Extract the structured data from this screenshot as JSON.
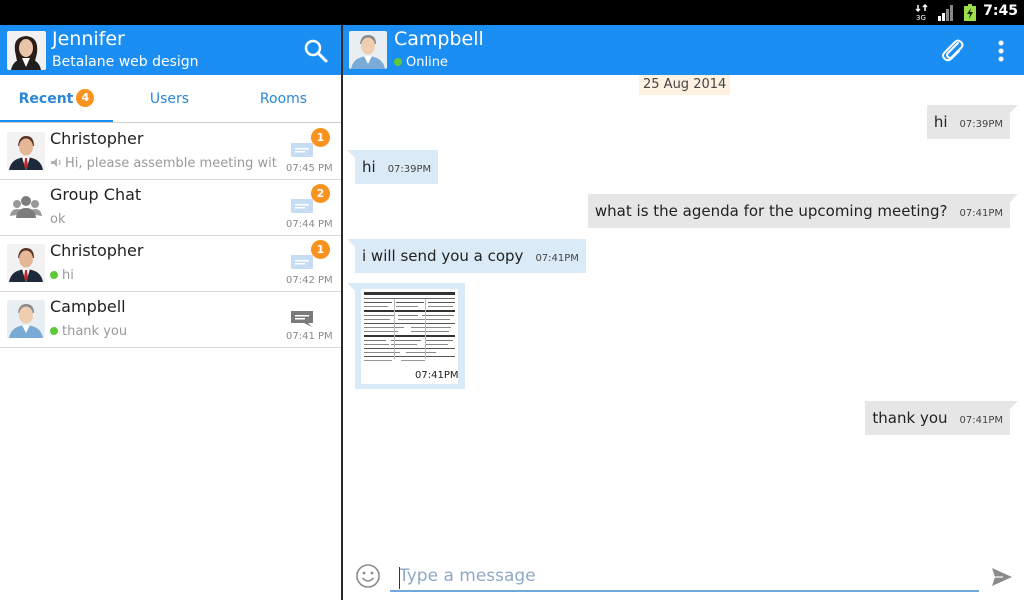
{
  "status_bar": {
    "time": "7:45",
    "network_label": "3G"
  },
  "me": {
    "name": "Jennifer",
    "subtitle": "Betalane web design"
  },
  "tabs": [
    {
      "label": "Recent",
      "badge": "4",
      "active": true
    },
    {
      "label": "Users"
    },
    {
      "label": "Rooms"
    }
  ],
  "conversations": [
    {
      "name": "Christopher",
      "message": "Hi, please assemble meeting with",
      "time": "07:45 PM",
      "badge": "1",
      "has_voice": true
    },
    {
      "name": "Group Chat",
      "message": "ok",
      "time": "07:44 PM",
      "badge": "2",
      "group": true
    },
    {
      "name": "Christopher",
      "message": "hi",
      "time": "07:42 PM",
      "badge": "1",
      "online": true
    },
    {
      "name": "Campbell",
      "message": "thank you",
      "time": "07:41 PM",
      "online": true,
      "read": true
    }
  ],
  "chat": {
    "contact": "Campbell",
    "status": "Online",
    "date": "25 Aug 2014",
    "messages": [
      {
        "dir": "out",
        "text": "hi",
        "time": "07:39PM"
      },
      {
        "dir": "in",
        "text": "hi",
        "time": "07:39PM"
      },
      {
        "dir": "out",
        "text": "what is the agenda for the upcoming meeting?",
        "time": "07:41PM"
      },
      {
        "dir": "in",
        "text": "i will send you a copy",
        "time": "07:41PM"
      },
      {
        "dir": "in",
        "type": "image",
        "time": "07:41PM"
      },
      {
        "dir": "out",
        "text": "thank you",
        "time": "07:41PM"
      }
    ]
  },
  "composer": {
    "placeholder": "Type a message"
  },
  "colors": {
    "header": "#1b8ef3",
    "badge": "#f7931e",
    "online": "#5cc93b",
    "incoming": "#dbeaf7",
    "outgoing": "#e6e6e6"
  }
}
